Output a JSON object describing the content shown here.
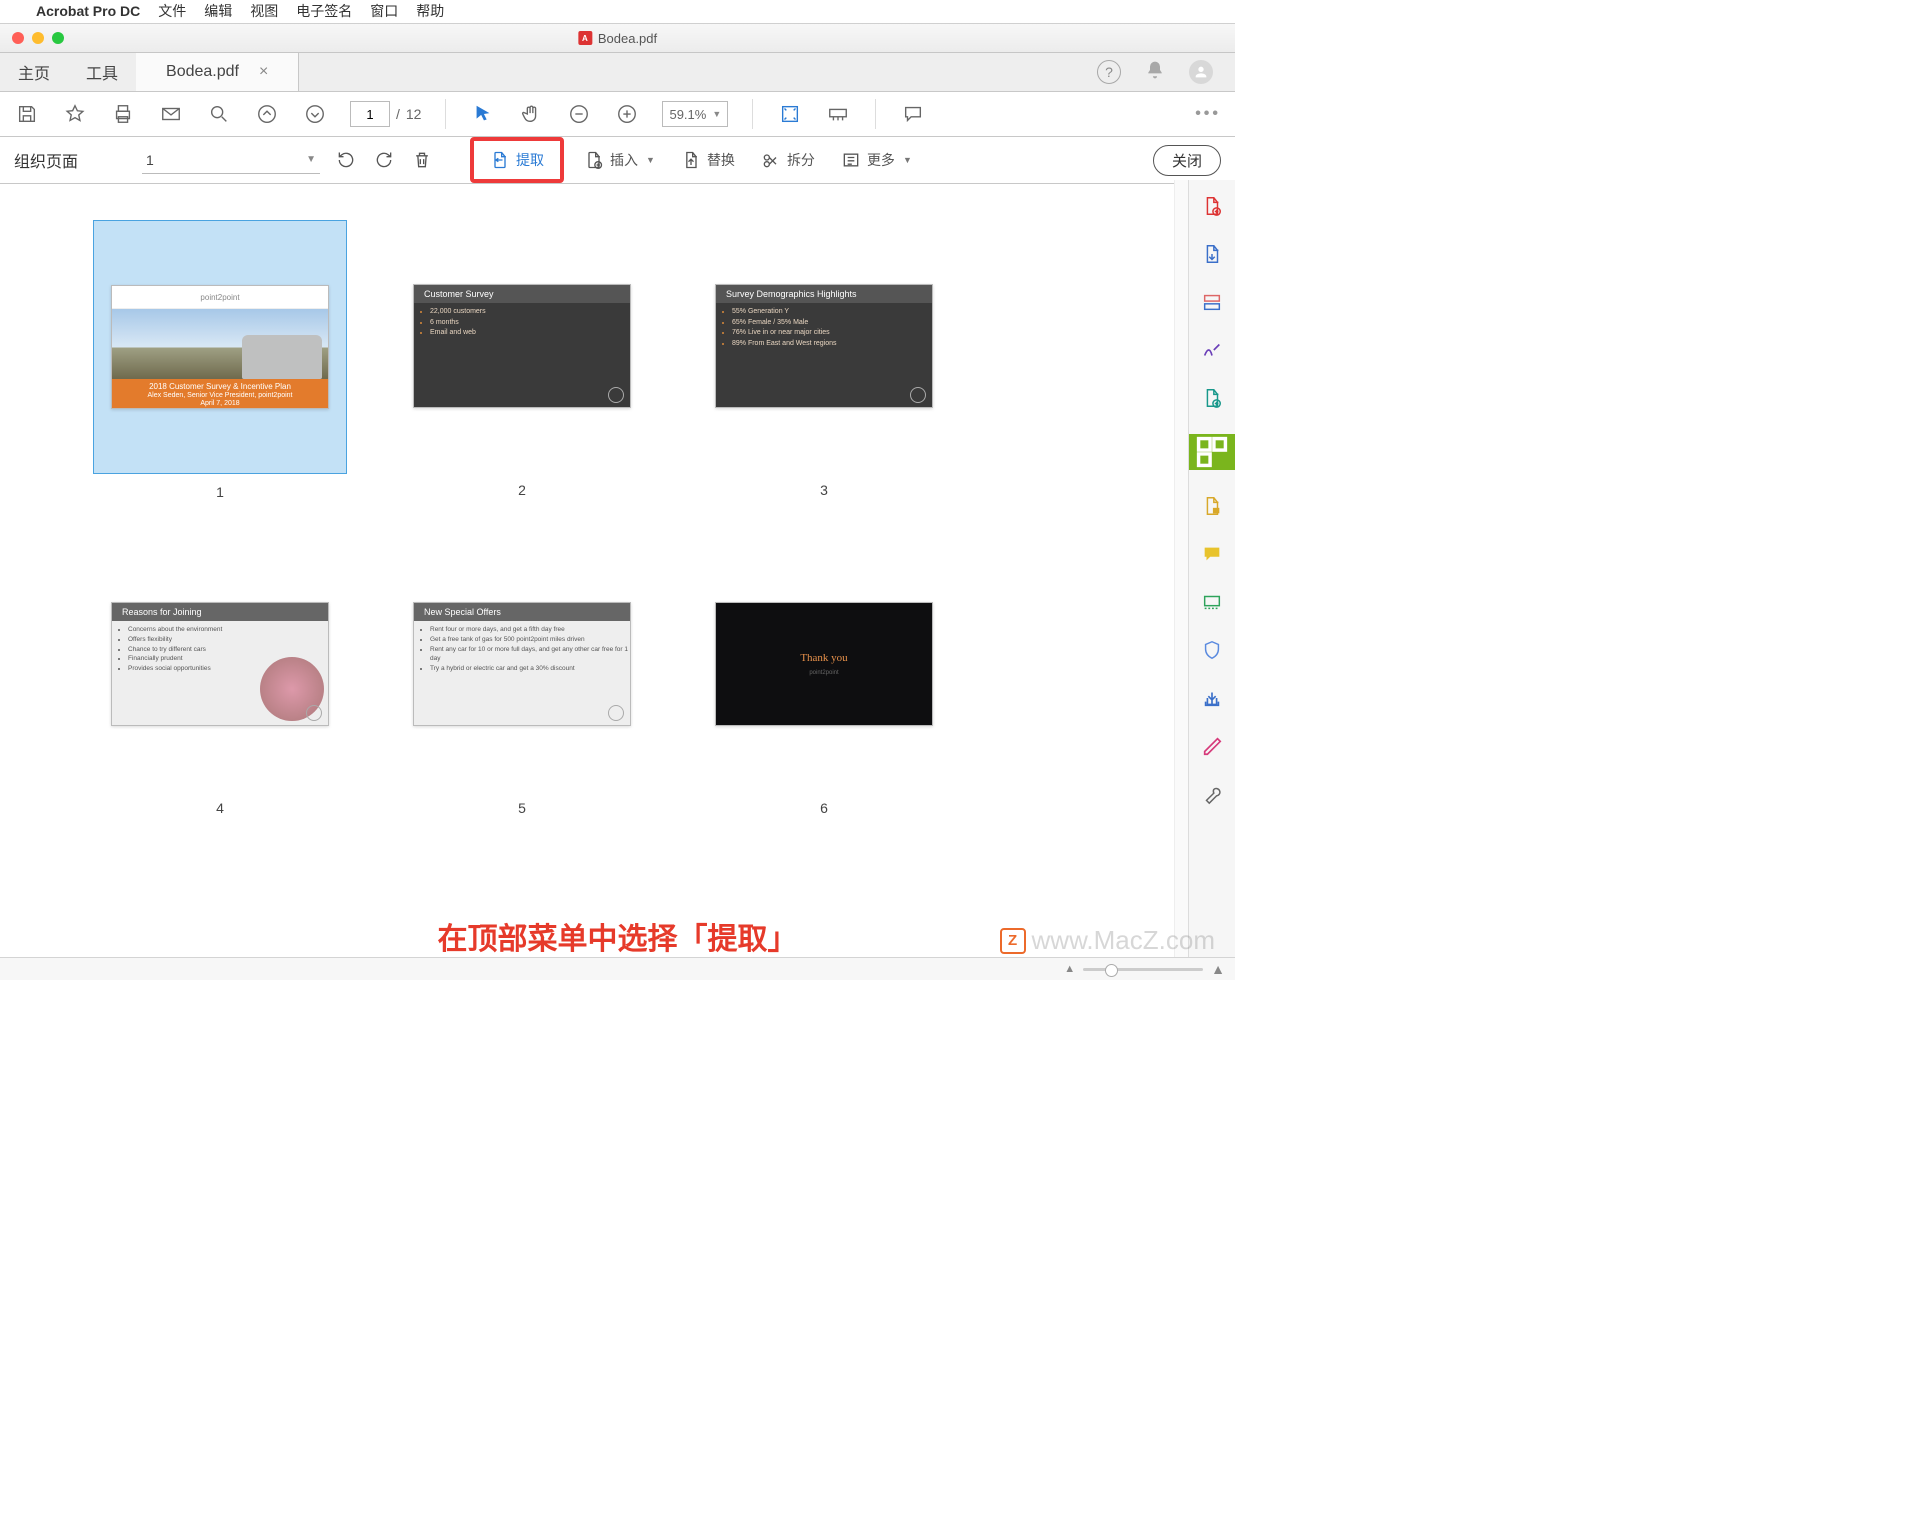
{
  "menubar": {
    "app": "Acrobat Pro DC",
    "items": [
      "文件",
      "编辑",
      "视图",
      "电子签名",
      "窗口",
      "帮助"
    ]
  },
  "window": {
    "title": "Bodea.pdf"
  },
  "tabs": {
    "home": "主页",
    "tools": "工具",
    "doc": "Bodea.pdf"
  },
  "toolbar": {
    "page_current": "1",
    "page_sep": "/",
    "page_total": "12",
    "zoom": "59.1%"
  },
  "orgbar": {
    "title": "组织页面",
    "page_sel": "1",
    "extract": "提取",
    "insert": "插入",
    "replace": "替换",
    "split": "拆分",
    "more": "更多",
    "close": "关闭"
  },
  "pages": {
    "nums": [
      "1",
      "2",
      "3",
      "4",
      "5",
      "6"
    ],
    "s1": {
      "logo": "point2point",
      "title": "2018 Customer Survey & Incentive Plan",
      "sub": "Alex Seden, Senior Vice President, point2point",
      "date": "April 7, 2018"
    },
    "s2": {
      "hd": "Customer Survey",
      "b": [
        "22,000 customers",
        "6 months",
        "Email and web"
      ]
    },
    "s3": {
      "hd": "Survey Demographics Highlights",
      "b": [
        "55% Generation Y",
        "65% Female / 35% Male",
        "76% Live in or near major cities",
        "89% From East and West regions"
      ]
    },
    "s4": {
      "hd": "Reasons for Joining",
      "b": [
        "Concerns about the environment",
        "Offers flexibility",
        "Chance to try different cars",
        "Financially prudent",
        "Provides social opportunities"
      ]
    },
    "s5": {
      "hd": "New Special Offers",
      "b": [
        "Rent four or more days, and get a fifth day free",
        "Get a free tank of gas for 500 point2point miles driven",
        "Rent any car for 10 or more full days, and get any other car free for 1 day",
        "Try a hybrid or electric car and get a 30% discount"
      ]
    },
    "s6": {
      "ty": "Thank you",
      "sub": "point2point"
    }
  },
  "annotation": "在顶部菜单中选择「提取」",
  "watermark": "www.MacZ.com"
}
